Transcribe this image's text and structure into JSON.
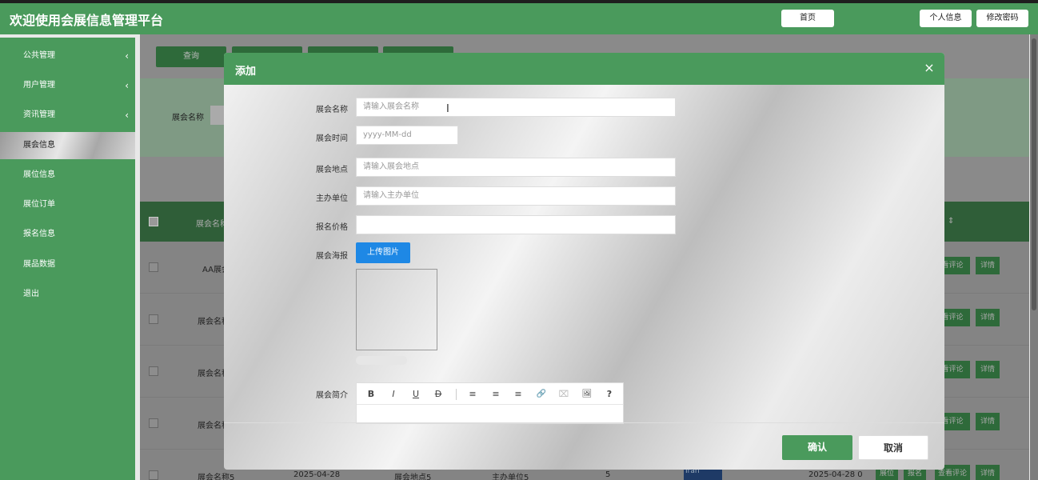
{
  "header": {
    "title": "欢迎使用会展信息管理平台",
    "home_label": "首页",
    "profile_label": "个人信息",
    "password_label": "修改密码"
  },
  "sidebar": {
    "items": [
      {
        "label": "公共管理",
        "arrow": "‹"
      },
      {
        "label": "用户管理",
        "arrow": "‹"
      },
      {
        "label": "资讯管理",
        "arrow": "‹"
      },
      {
        "label": "展会信息"
      },
      {
        "label": "展位信息"
      },
      {
        "label": "展位订单"
      },
      {
        "label": "报名信息"
      },
      {
        "label": "展品数据"
      },
      {
        "label": "退出"
      }
    ]
  },
  "background": {
    "query_label": "查询",
    "search_label": "展会名称",
    "table": {
      "col_name": "展会名称",
      "col_sort": "⇕",
      "rows": [
        {
          "name": "AA展会"
        },
        {
          "name": "展会名称"
        },
        {
          "name": "展会名称"
        },
        {
          "name": "展会名称"
        },
        {
          "name": "展会名称5",
          "date": "2025-04-28",
          "place": "展会地点5",
          "host": "主办单位5",
          "price": "5",
          "poster": "Iran",
          "date2": "2025-04-28 0"
        }
      ],
      "ops": {
        "booth": "展位",
        "signup": "报名",
        "comments": "看评论",
        "comments_full": "查看评论",
        "detail": "详情"
      }
    }
  },
  "modal": {
    "title": "添加",
    "close": "×",
    "fields": {
      "name": {
        "label": "展会名称",
        "placeholder": "请输入展会名称"
      },
      "time": {
        "label": "展会时间",
        "placeholder": "yyyy-MM-dd"
      },
      "place": {
        "label": "展会地点",
        "placeholder": "请输入展会地点"
      },
      "host": {
        "label": "主办单位",
        "placeholder": "请输入主办单位"
      },
      "price": {
        "label": "报名价格",
        "placeholder": ""
      },
      "poster": {
        "label": "展会海报",
        "upload_label": "上传图片"
      },
      "intro": {
        "label": "展会简介"
      }
    },
    "editor_tools": [
      "B",
      "I",
      "U",
      "D",
      "≡",
      "≡",
      "≡",
      "🔗",
      "⌧",
      "🖼",
      "?"
    ],
    "confirm_label": "确认",
    "cancel_label": "取消"
  },
  "colors": {
    "brand": "#4a9a5c",
    "upload": "#1e88e5"
  }
}
